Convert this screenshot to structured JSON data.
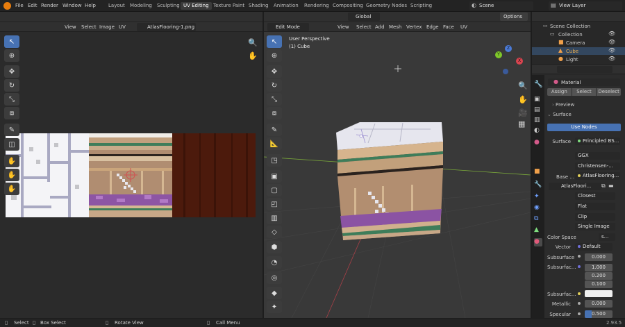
{
  "topbar": {
    "menus": [
      "File",
      "Edit",
      "Render",
      "Window",
      "Help"
    ],
    "workspaces": [
      "Layout",
      "Modeling",
      "Sculpting",
      "UV Editing",
      "Texture Paint",
      "Shading",
      "Animation",
      "Rendering",
      "Compositing",
      "Geometry Nodes",
      "Scripting"
    ],
    "active_workspace": "UV Editing",
    "scene": "Scene",
    "view_layer": "View Layer"
  },
  "uv_editor": {
    "menus": [
      "View",
      "Select",
      "Image",
      "UV"
    ],
    "image_name": "AtlasFlooring-1.png"
  },
  "viewport": {
    "mode": "Edit Mode",
    "menus": [
      "View",
      "Select",
      "Add",
      "Mesh",
      "Vertex",
      "Edge",
      "Face",
      "UV"
    ],
    "orientation": "Global",
    "options_label": "Options",
    "perspective_label": "User Perspective",
    "object_label": "(1) Cube",
    "axes": {
      "x": "X",
      "y": "Y",
      "z": "Z"
    }
  },
  "outliner": {
    "root": "Scene Collection",
    "collection": "Collection",
    "items": [
      "Camera",
      "Cube",
      "Light"
    ],
    "selected": "Cube"
  },
  "properties": {
    "material_name": "Material",
    "assign": "Assign",
    "select": "Select",
    "deselect": "Deselect",
    "preview": "Preview",
    "surface_section": "Surface",
    "use_nodes": "Use Nodes",
    "surface_label": "Surface",
    "surface_value": "Principled BS...",
    "distribution": "GGX",
    "subsurface_method": "Christensen-...",
    "base_color_label": "Base ...",
    "base_color_value": "AtlasFlooring...",
    "image_field": "AtlasFloori...",
    "interpolation": "Closest",
    "projection": "Flat",
    "extension": "Clip",
    "source": "Single Image",
    "color_space_label": "Color Space",
    "color_space_value": "s...",
    "vector_label": "Vector",
    "vector_value": "Default",
    "subsurface_label": "Subsurface",
    "subsurface_value": "0.000",
    "subsurface_radius_label": "Subsurfac...",
    "subsurface_radius": [
      "1.000",
      "0.200",
      "0.100"
    ],
    "subsurface_color_label": "Subsurfac...",
    "metallic_label": "Metallic",
    "metallic_value": "0.000",
    "specular_label": "Specular",
    "specular_value": "0.500"
  },
  "statusbar": {
    "select": "Select",
    "box_select": "Box Select",
    "rotate_view": "Rotate View",
    "call_menu": "Call Menu",
    "version": "2.93.5"
  }
}
